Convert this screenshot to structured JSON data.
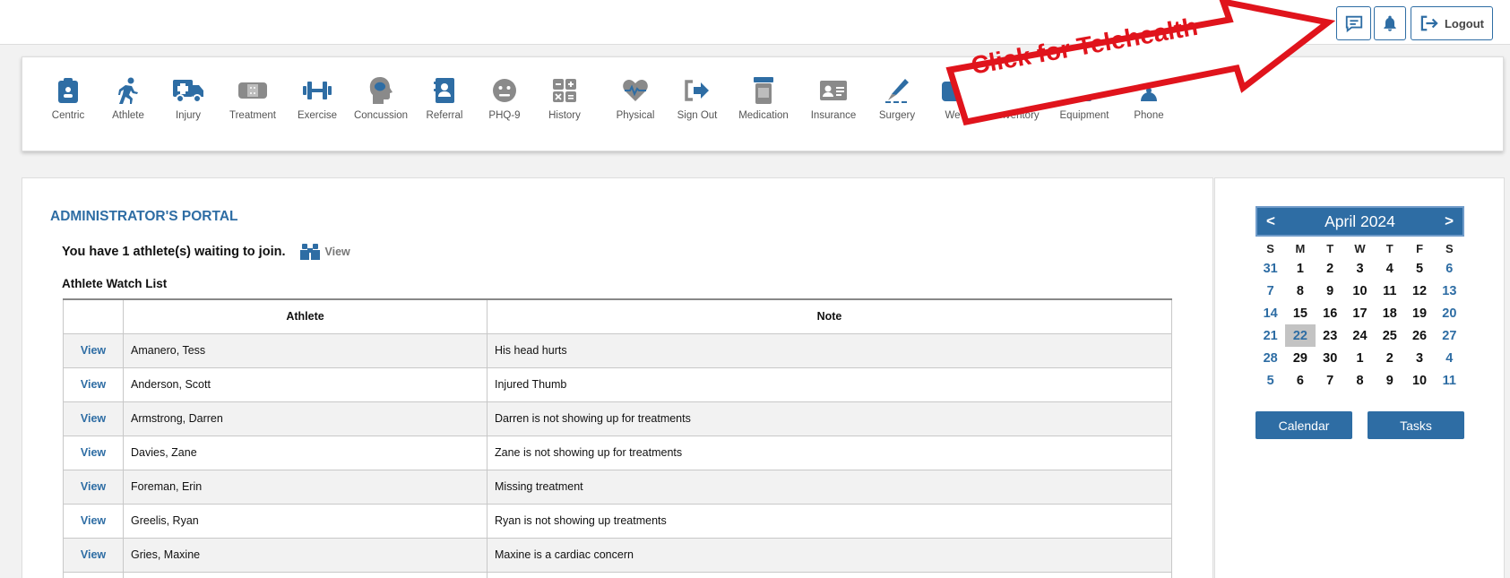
{
  "topbar": {
    "logout_label": "Logout",
    "icons": [
      "chat-icon",
      "bell-icon",
      "logout-icon"
    ]
  },
  "toolbar": {
    "items": [
      {
        "label": "Centric",
        "icon": "clipboard-badge-icon"
      },
      {
        "label": "Athlete",
        "icon": "running-person-icon"
      },
      {
        "label": "Injury",
        "icon": "ambulance-icon"
      },
      {
        "label": "Treatment",
        "icon": "bandage-icon"
      },
      {
        "label": "Exercise",
        "icon": "dumbbell-icon"
      },
      {
        "label": "Concussion",
        "icon": "head-brain-icon"
      },
      {
        "label": "Referral",
        "icon": "contact-book-icon"
      },
      {
        "label": "PHQ-9",
        "icon": "neutral-face-icon"
      },
      {
        "label": "History",
        "icon": "calculator-icon"
      },
      {
        "label": "Physical",
        "icon": "heartbeat-icon"
      },
      {
        "label": "Sign Out",
        "icon": "sign-out-icon"
      },
      {
        "label": "Medication",
        "icon": "pill-bottle-icon"
      },
      {
        "label": "Insurance",
        "icon": "id-card-icon"
      },
      {
        "label": "Surgery",
        "icon": "scalpel-icon"
      },
      {
        "label": "We",
        "icon": "weight-icon"
      },
      {
        "label": "Inventory",
        "icon": "inventory-icon"
      },
      {
        "label": "Equipment",
        "icon": "equipment-icon"
      },
      {
        "label": "Phone",
        "icon": "phone-icon"
      }
    ]
  },
  "callout": {
    "text": "Click for Telehealth",
    "color": "#e0141c"
  },
  "main": {
    "title": "ADMINISTRATOR'S PORTAL",
    "waiting_text": "You have 1 athlete(s) waiting to join.",
    "waiting_view": "View",
    "watch_list_title": "Athlete Watch List",
    "table": {
      "headers": [
        "",
        "Athlete",
        "Note"
      ],
      "rows": [
        {
          "action": "View",
          "athlete": "Amanero, Tess",
          "note": "His head hurts"
        },
        {
          "action": "View",
          "athlete": "Anderson, Scott",
          "note": "Injured Thumb"
        },
        {
          "action": "View",
          "athlete": "Armstrong, Darren",
          "note": "Darren is not showing up for treatments"
        },
        {
          "action": "View",
          "athlete": "Davies, Zane",
          "note": "Zane is not showing up for treatments"
        },
        {
          "action": "View",
          "athlete": "Foreman, Erin",
          "note": "Missing treatment"
        },
        {
          "action": "View",
          "athlete": "Greelis, Ryan",
          "note": "Ryan is not showing up treatments"
        },
        {
          "action": "View",
          "athlete": "Gries, Maxine",
          "note": "Maxine is a cardiac concern"
        }
      ]
    }
  },
  "calendar": {
    "prev": "<",
    "next": ">",
    "month_label": "April 2024",
    "weekdays": [
      "S",
      "M",
      "T",
      "W",
      "T",
      "F",
      "S"
    ],
    "days": [
      "31",
      "1",
      "2",
      "3",
      "4",
      "5",
      "6",
      "7",
      "8",
      "9",
      "10",
      "11",
      "12",
      "13",
      "14",
      "15",
      "16",
      "17",
      "18",
      "19",
      "20",
      "21",
      "22",
      "23",
      "24",
      "25",
      "26",
      "27",
      "28",
      "29",
      "30",
      "1",
      "2",
      "3",
      "4",
      "5",
      "6",
      "7",
      "8",
      "9",
      "10",
      "11"
    ],
    "today": "22",
    "calendar_button": "Calendar",
    "tasks_button": "Tasks"
  },
  "colors": {
    "accent": "#2e6da4",
    "icon_grey": "#8a8a8a",
    "callout_red": "#e0141c"
  }
}
